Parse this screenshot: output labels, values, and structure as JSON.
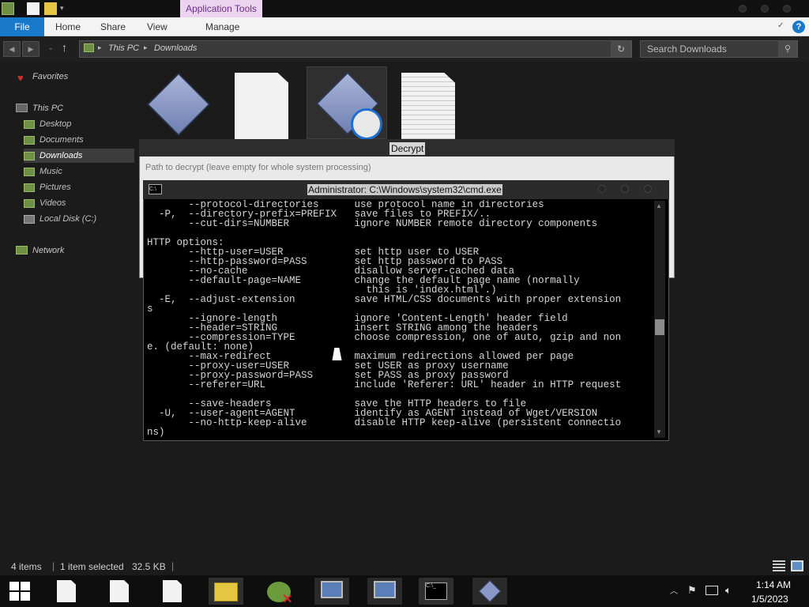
{
  "titlebar": {
    "contextual_tab": "Application Tools"
  },
  "ribbon": {
    "file": "File",
    "tabs": [
      "Home",
      "Share",
      "View",
      "Manage"
    ],
    "help": "?"
  },
  "address": {
    "segments": [
      "This PC",
      "Downloads"
    ]
  },
  "search": {
    "placeholder": "Search Downloads"
  },
  "nav_pane": {
    "favorites": "Favorites",
    "this_pc": "This PC",
    "items": [
      "Desktop",
      "Documents",
      "Downloads",
      "Music",
      "Pictures",
      "Videos",
      "Local Disk (C:)"
    ],
    "selected": "Downloads",
    "network": "Network"
  },
  "decrypt_window": {
    "title": "Decrypt",
    "hint": "Path to decrypt (leave empty for whole system processing)"
  },
  "cmd_window": {
    "title": "Administrator: C:\\Windows\\system32\\cmd.exe",
    "lines": [
      "       --protocol-directories      use protocol name in directories",
      "  -P,  --directory-prefix=PREFIX   save files to PREFIX/..",
      "       --cut-dirs=NUMBER           ignore NUMBER remote directory components",
      "",
      "HTTP options:",
      "       --http-user=USER            set http user to USER",
      "       --http-password=PASS        set http password to PASS",
      "       --no-cache                  disallow server-cached data",
      "       --default-page=NAME         change the default page name (normally",
      "                                     this is 'index.html'.)",
      "  -E,  --adjust-extension          save HTML/CSS documents with proper extension",
      "s",
      "       --ignore-length             ignore 'Content-Length' header field",
      "       --header=STRING             insert STRING among the headers",
      "       --compression=TYPE          choose compression, one of auto, gzip and non",
      "e. (default: none)",
      "       --max-redirect              maximum redirections allowed per page",
      "       --proxy-user=USER           set USER as proxy username",
      "       --proxy-password=PASS       set PASS as proxy password",
      "       --referer=URL               include 'Referer: URL' header in HTTP request",
      "",
      "       --save-headers              save the HTTP headers to file",
      "  -U,  --user-agent=AGENT          identify as AGENT instead of Wget/VERSION",
      "       --no-http-keep-alive        disable HTTP keep-alive (persistent connectio",
      "ns)"
    ]
  },
  "status_bar": {
    "items": "4 items",
    "selected": "1 item selected",
    "size": "32.5 KB"
  },
  "taskbar": {
    "time": "1:14 AM",
    "date": "1/5/2023"
  }
}
